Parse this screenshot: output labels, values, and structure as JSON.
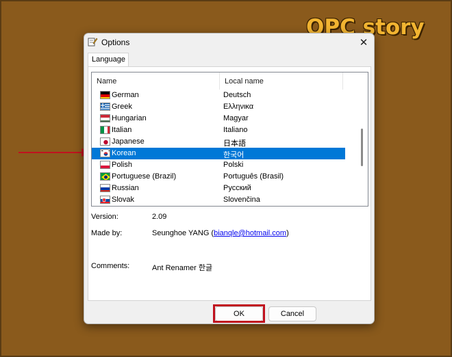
{
  "watermark": "OPC story",
  "window": {
    "title": "Options",
    "close_glyph": "✕"
  },
  "tabs": [
    {
      "label": "Language"
    }
  ],
  "language_list": {
    "columns": {
      "name": "Name",
      "local": "Local name"
    },
    "rows": [
      {
        "name": "German",
        "local": "Deutsch",
        "flag": "de"
      },
      {
        "name": "Greek",
        "local": "Ελληνικα",
        "flag": "gr"
      },
      {
        "name": "Hungarian",
        "local": "Magyar",
        "flag": "hu"
      },
      {
        "name": "Italian",
        "local": "Italiano",
        "flag": "it"
      },
      {
        "name": "Japanese",
        "local": "日本語",
        "flag": "jp"
      },
      {
        "name": "Korean",
        "local": "한국어",
        "flag": "kr",
        "selected": true
      },
      {
        "name": "Polish",
        "local": "Polski",
        "flag": "pl"
      },
      {
        "name": "Portuguese (Brazil)",
        "local": "Português (Brasil)",
        "flag": "br"
      },
      {
        "name": "Russian",
        "local": "Русский",
        "flag": "ru"
      },
      {
        "name": "Slovak",
        "local": "Slovenčina",
        "flag": "sk"
      }
    ]
  },
  "info": {
    "version_label": "Version:",
    "version_value": "2.09",
    "made_by_label": "Made by:",
    "made_by_name": "Seunghoe YANG (",
    "made_by_email": "bianqle@hotmail.com",
    "made_by_close": ")",
    "comments_label": "Comments:",
    "comments_value": "Ant Renamer 한글"
  },
  "buttons": {
    "ok": "OK",
    "cancel": "Cancel"
  },
  "colors": {
    "selection": "#0078d7",
    "highlight_box": "#c1121f",
    "background": "#8a5a1c",
    "watermark": "#f2b431"
  }
}
